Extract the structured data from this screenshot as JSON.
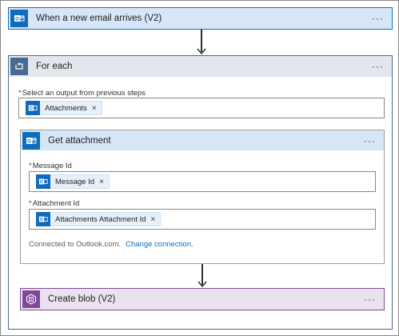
{
  "trigger": {
    "title": "When a new email arrives (V2)",
    "menu": "···",
    "icon": "outlook-icon",
    "header_color": "#d7e6f7"
  },
  "foreach": {
    "title": "For each",
    "menu": "···",
    "icon": "loop-icon",
    "header_color": "#e3e7ed",
    "select_label": "Select an output from previous steps",
    "select_token": "Attachments"
  },
  "get_attachment": {
    "title": "Get attachment",
    "menu": "···",
    "icon": "outlook-icon",
    "header_color": "#d7e6f7",
    "message_id_label": "Message Id",
    "message_id_token": "Message Id",
    "attachment_id_label": "Attachment Id",
    "attachment_id_token": "Attachments Attachment Id",
    "connected_text": "Connected to Outlook.com.",
    "change_connection": "Change connection."
  },
  "create_blob": {
    "title": "Create blob (V2)",
    "menu": "···",
    "icon": "blob-storage-icon",
    "header_color": "#ebe2f0"
  },
  "required_marker": "*",
  "token_remove": "×"
}
